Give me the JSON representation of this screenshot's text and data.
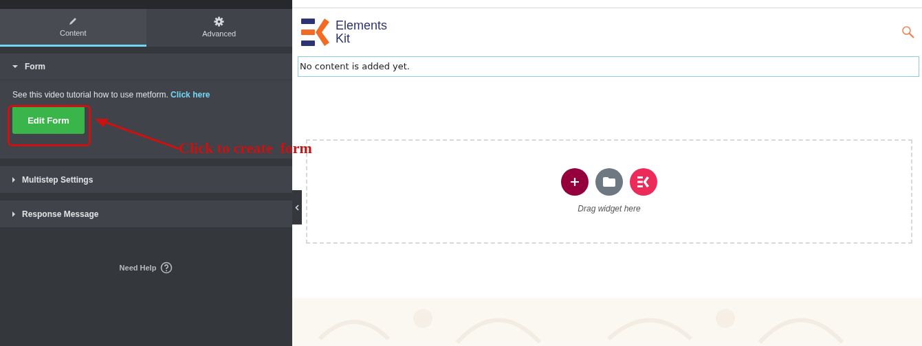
{
  "panel": {
    "tabs": [
      {
        "label": "Content",
        "selected": true
      },
      {
        "label": "Advanced",
        "selected": false
      }
    ],
    "sections": [
      {
        "title": "Form",
        "expanded": true,
        "tutorial_text": "See this video tutorial how to use metform.",
        "tutorial_link": "Click here",
        "button": "Edit Form"
      },
      {
        "title": "Multistep Settings",
        "expanded": false
      },
      {
        "title": "Response Message",
        "expanded": false
      }
    ],
    "help": "Need Help"
  },
  "annotation": {
    "text": "Click to create  form"
  },
  "preview": {
    "logo": {
      "line_1": "Elements",
      "line_2": "Kit"
    },
    "notice": "No content is added yet.",
    "drop_zone": {
      "hint": "Drag widget here"
    }
  }
}
